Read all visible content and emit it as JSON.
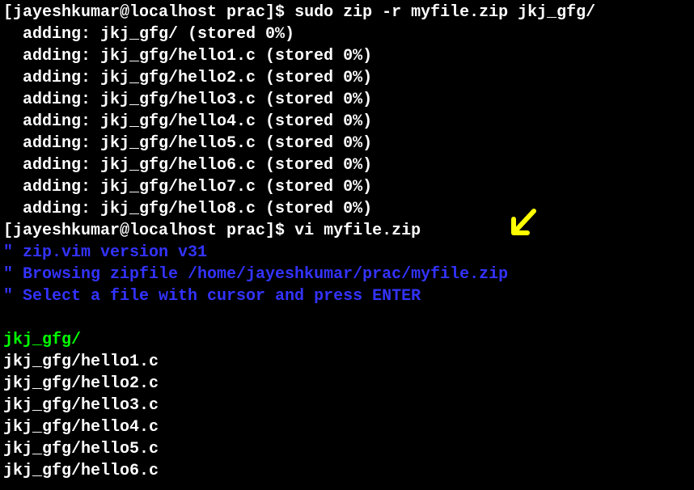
{
  "prompt1": {
    "full": "[jayeshkumar@localhost prac]$ ",
    "cmd": "sudo zip -r myfile.zip jkj_gfg/"
  },
  "zip_output": [
    "adding: jkj_gfg/ (stored 0%)",
    "adding: jkj_gfg/hello1.c (stored 0%)",
    "adding: jkj_gfg/hello2.c (stored 0%)",
    "adding: jkj_gfg/hello3.c (stored 0%)",
    "adding: jkj_gfg/hello4.c (stored 0%)",
    "adding: jkj_gfg/hello5.c (stored 0%)",
    "adding: jkj_gfg/hello6.c (stored 0%)",
    "adding: jkj_gfg/hello7.c (stored 0%)",
    "adding: jkj_gfg/hello8.c (stored 0%)"
  ],
  "prompt2": {
    "full": "[jayeshkumar@localhost prac]$ ",
    "cmd": "vi myfile.zip"
  },
  "vim_header": [
    "\" zip.vim version v31",
    "\" Browsing zipfile /home/jayeshkumar/prac/myfile.zip",
    "\" Select a file with cursor and press ENTER"
  ],
  "dir_entry": "jkj_gfg/",
  "file_entries": [
    "jkj_gfg/hello1.c",
    "jkj_gfg/hello2.c",
    "jkj_gfg/hello3.c",
    "jkj_gfg/hello4.c",
    "jkj_gfg/hello5.c",
    "jkj_gfg/hello6.c"
  ]
}
